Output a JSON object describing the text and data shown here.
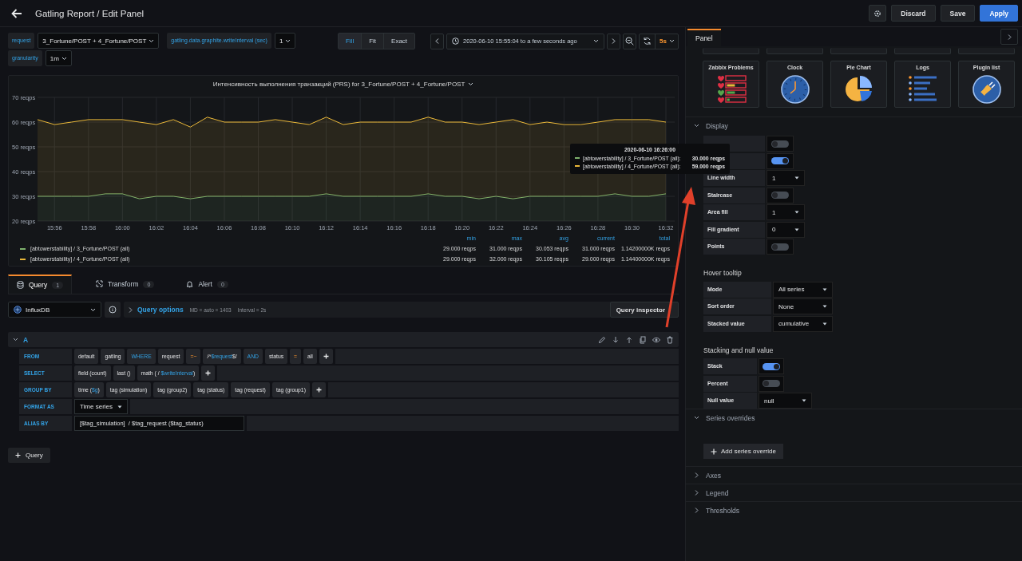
{
  "header": {
    "title": "Gatling Report / Edit Panel",
    "buttons": [
      {
        "label": "Discard",
        "kind": "secondary"
      },
      {
        "label": "Save",
        "kind": "secondary"
      },
      {
        "label": "Apply",
        "kind": "primary"
      }
    ]
  },
  "variables": [
    {
      "label": "request",
      "value": "3_Fortune/POST + 4_Fortune/POST"
    },
    {
      "label": "gatling.data.graphite.writeInterval (sec)",
      "value": "1"
    },
    {
      "label": "granularity",
      "value": "1m"
    }
  ],
  "zoom_modes": [
    {
      "label": "Fill",
      "selected": true
    },
    {
      "label": "Fit",
      "selected": false
    },
    {
      "label": "Exact",
      "selected": false
    }
  ],
  "time_range": "2020-06-10 15:55:04 to a few seconds ago",
  "refresh": "5s",
  "panel": {
    "title": "Интенсивность выполнения транзакций (PRS) for 3_Fortune/POST + 4_Fortune/POST",
    "chart_data": {
      "type": "area",
      "stacked": true,
      "grid": true,
      "xlim": [
        955,
        992
      ],
      "x": [
        955,
        956,
        957,
        958,
        959,
        960,
        961,
        962,
        963,
        964,
        965,
        966,
        967,
        968,
        969,
        970,
        971,
        972,
        973,
        974,
        975,
        976,
        977,
        978,
        979,
        980,
        981,
        982,
        983,
        984,
        985,
        986,
        987,
        988,
        989,
        990,
        991,
        992
      ],
      "series": [
        {
          "name": "[abtowerstability] / 3_Fortune/POST (all)",
          "color": "#7eb26d",
          "values": [
            30,
            30,
            30,
            30,
            31,
            31,
            29,
            30,
            30,
            29,
            30,
            30,
            30,
            30,
            30,
            30,
            30,
            31,
            30,
            30,
            30,
            30,
            30,
            31,
            30,
            30,
            29,
            30,
            29,
            30,
            30,
            30,
            30,
            30,
            31,
            30,
            30,
            31
          ]
        },
        {
          "name": "[abtowerstability] / 4_Fortune/POST (all)",
          "color": "#eab839",
          "values": [
            31,
            29,
            30,
            31,
            30,
            30,
            31,
            29,
            31,
            29,
            32,
            30,
            30,
            30,
            31,
            30,
            29,
            31,
            29,
            30,
            30,
            30,
            30,
            31,
            30,
            30,
            30,
            30,
            32,
            29,
            30,
            29,
            29,
            30,
            30,
            31,
            31,
            29
          ]
        }
      ],
      "ylim": [
        20,
        70
      ],
      "yticks": [
        {
          "value": 20,
          "label": "20 reqps"
        },
        {
          "value": 30,
          "label": "30 reqps"
        },
        {
          "value": 40,
          "label": "40 reqps"
        },
        {
          "value": 50,
          "label": "50 reqps"
        },
        {
          "value": 60,
          "label": "60 reqps"
        },
        {
          "value": 70,
          "label": "70 reqps"
        }
      ],
      "xticks": [
        {
          "value": 956,
          "label": "15:56"
        },
        {
          "value": 958,
          "label": "15:58"
        },
        {
          "value": 960,
          "label": "16:00"
        },
        {
          "value": 962,
          "label": "16:02"
        },
        {
          "value": 964,
          "label": "16:04"
        },
        {
          "value": 966,
          "label": "16:06"
        },
        {
          "value": 968,
          "label": "16:08"
        },
        {
          "value": 970,
          "label": "16:10"
        },
        {
          "value": 972,
          "label": "16:12"
        },
        {
          "value": 974,
          "label": "16:14"
        },
        {
          "value": 976,
          "label": "16:16"
        },
        {
          "value": 978,
          "label": "16:18"
        },
        {
          "value": 980,
          "label": "16:20"
        },
        {
          "value": 982,
          "label": "16:22"
        },
        {
          "value": 984,
          "label": "16:24"
        },
        {
          "value": 986,
          "label": "16:26"
        },
        {
          "value": 988,
          "label": "16:28"
        },
        {
          "value": 990,
          "label": "16:30"
        },
        {
          "value": 992,
          "label": "16:32"
        }
      ]
    },
    "legend": {
      "columns": [
        "min",
        "max",
        "avg",
        "current",
        "total"
      ],
      "rows": [
        {
          "values": [
            "29.000 reqps",
            "31.000 reqps",
            "30.053 reqps",
            "31.000 reqps",
            "1.14200000K reqps"
          ]
        },
        {
          "values": [
            "29.000 reqps",
            "32.000 reqps",
            "30.105 reqps",
            "29.000 reqps",
            "1.14400000K reqps"
          ]
        }
      ]
    },
    "tooltip": {
      "time": "2020-06-10 16:26:00",
      "rows": [
        {
          "name": "[abtowerstability] / 3_Fortune/POST (all):",
          "value": "30.000 reqps",
          "color": "#7eb26d"
        },
        {
          "name": "[abtowerstability] / 4_Fortune/POST (all):",
          "value": "59.000 reqps",
          "color": "#eab839"
        }
      ]
    }
  },
  "editor_tabs": [
    {
      "label": "Query",
      "count": "1",
      "kind": "query",
      "selected": true
    },
    {
      "label": "Transform",
      "count": "0",
      "kind": "transform",
      "selected": false
    },
    {
      "label": "Alert",
      "count": "0",
      "kind": "alert",
      "selected": false
    }
  ],
  "datasource": "InfluxDB",
  "query_options": {
    "label": "Query options",
    "details": [
      "MD = auto = 1403",
      "Interval = 2s"
    ]
  },
  "query_inspector": "Query inspector",
  "query": {
    "ref": "A",
    "expanded": true,
    "rows": [
      {
        "label": "FROM",
        "kind": "segments",
        "segments": [
          {
            "text": "default"
          },
          {
            "text": "gatling"
          },
          {
            "text": "WHERE",
            "kind": "keyword"
          },
          {
            "text": "request"
          },
          {
            "text": "=~",
            "kind": "operator"
          },
          {
            "parts": [
              {
                "text": "/^"
              },
              {
                "text": "$request",
                "kind": "variable"
              },
              {
                "text": "$/"
              }
            ]
          },
          {
            "text": "AND",
            "kind": "keyword"
          },
          {
            "text": "status"
          },
          {
            "text": "=",
            "kind": "operator"
          },
          {
            "text": "all"
          }
        ]
      },
      {
        "label": "SELECT",
        "kind": "segments",
        "segments": [
          {
            "text": "field (count)"
          },
          {
            "text": "last ()"
          },
          {
            "parts": [
              {
                "text": "math ( / "
              },
              {
                "text": "$writeInterval",
                "kind": "variable"
              },
              {
                "text": ")"
              }
            ]
          }
        ]
      },
      {
        "label": "GROUP BY",
        "kind": "segments",
        "segments": [
          {
            "parts": [
              {
                "text": "time ("
              },
              {
                "text": "$g",
                "kind": "variable"
              },
              {
                "text": ")"
              }
            ]
          },
          {
            "text": "tag (simulation)"
          },
          {
            "text": "tag (group2)"
          },
          {
            "text": "tag (status)"
          },
          {
            "text": "tag (request)"
          },
          {
            "text": "tag (group1)"
          }
        ]
      },
      {
        "label": "FORMAT AS",
        "kind": "select",
        "value": "Time series"
      },
      {
        "label": "ALIAS BY",
        "kind": "input",
        "value": "[$tag_simulation]  / $tag_request ($tag_status)"
      }
    ]
  },
  "add_query": "Query",
  "options_pane": {
    "tab": {
      "label": "Panel",
      "selected": true
    },
    "visualizations": [
      {
        "name": "Zabbix Problems",
        "kind": "zabbix"
      },
      {
        "name": "Clock",
        "kind": "clock"
      },
      {
        "name": "Pie Chart",
        "kind": "pie"
      },
      {
        "name": "Logs",
        "kind": "logs"
      },
      {
        "name": "Plugin list",
        "kind": "plugin"
      }
    ],
    "sections": [
      {
        "title": "Display",
        "expanded": true,
        "groups": [
          {
            "options": [
              {
                "kind": "toggle",
                "on": false
              },
              {
                "kind": "toggle",
                "on": true
              },
              {
                "label": "Line width",
                "kind": "select",
                "value": "1"
              },
              {
                "label": "Staircase",
                "kind": "toggle",
                "on": false
              },
              {
                "label": "Area fill",
                "kind": "select",
                "value": "1"
              },
              {
                "label": "Fill gradient",
                "kind": "select",
                "value": "0"
              },
              {
                "label": "Points",
                "kind": "toggle",
                "on": false
              }
            ]
          },
          {
            "title": "Hover tooltip",
            "options": [
              {
                "label": "Mode",
                "kind": "select",
                "value": "All series"
              },
              {
                "label": "Sort order",
                "kind": "select",
                "value": "None"
              },
              {
                "label": "Stacked value",
                "kind": "select",
                "value": "cumulative"
              }
            ]
          },
          {
            "title": "Stacking and null value",
            "options": [
              {
                "label": "Stack",
                "kind": "toggle",
                "on": true
              },
              {
                "label": "Percent",
                "kind": "toggle",
                "on": false
              },
              {
                "label": "Null value",
                "kind": "select",
                "value": "null"
              }
            ]
          }
        ]
      },
      {
        "title": "Series overrides",
        "expanded": true,
        "button": "Add series override"
      },
      {
        "title": "Axes",
        "expanded": false
      },
      {
        "title": "Legend",
        "expanded": false
      },
      {
        "title": "Thresholds",
        "expanded": false
      }
    ]
  }
}
